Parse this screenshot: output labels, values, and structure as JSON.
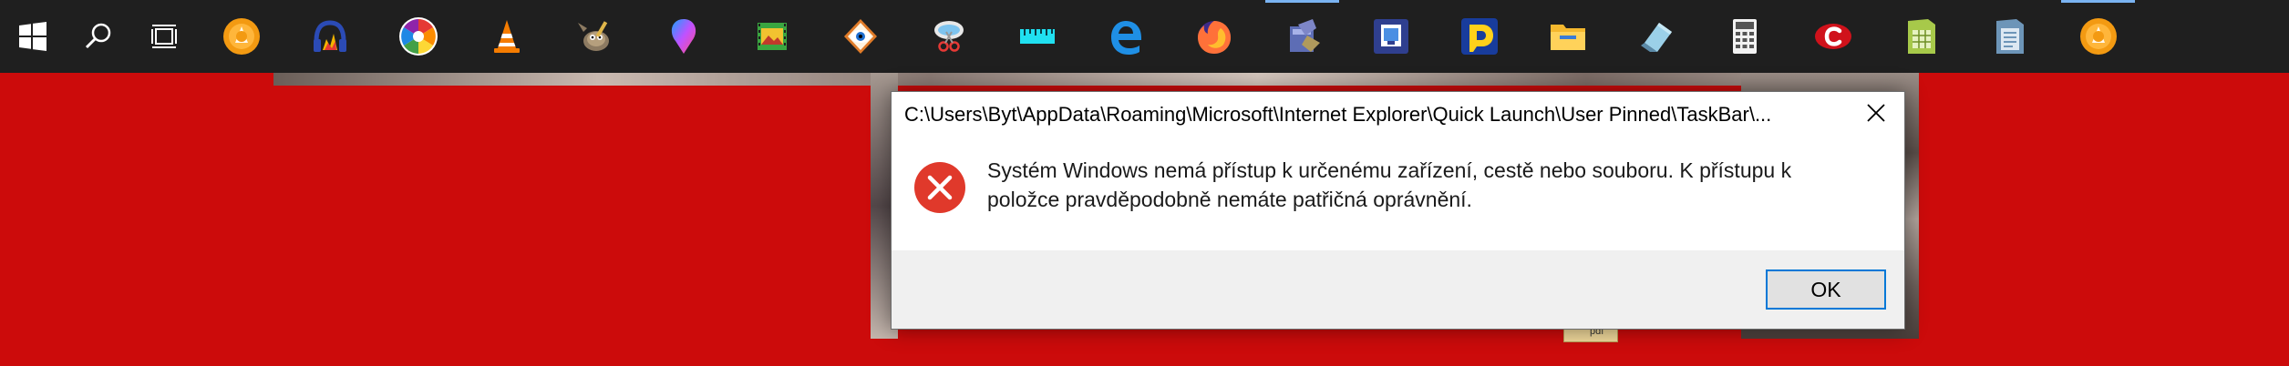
{
  "taskbar": {
    "pinned": [
      {
        "icon": "start-windows-icon"
      },
      {
        "icon": "search-icon"
      },
      {
        "icon": "task-view-icon"
      },
      {
        "icon": "orange-circle-app-icon"
      },
      {
        "icon": "audio-editor-icon"
      },
      {
        "icon": "aperture-icon"
      },
      {
        "icon": "vlc-cone-icon"
      },
      {
        "icon": "gimp-icon"
      },
      {
        "icon": "paint-balloon-icon"
      },
      {
        "icon": "film-strip-icon"
      },
      {
        "icon": "eye-viewer-icon"
      },
      {
        "icon": "scissors-tool-icon"
      },
      {
        "icon": "cyan-ruler-icon"
      },
      {
        "icon": "edge-browser-icon"
      },
      {
        "icon": "firefox-icon"
      },
      {
        "icon": "archive-tool-icon",
        "active": true
      },
      {
        "icon": "screen-capture-icon"
      },
      {
        "icon": "yellow-d-app-icon"
      },
      {
        "icon": "file-explorer-icon"
      },
      {
        "icon": "eraser-icon"
      },
      {
        "icon": "calculator-icon"
      },
      {
        "icon": "red-c-app-icon"
      },
      {
        "icon": "green-spreadsheet-icon"
      },
      {
        "icon": "document-viewer-icon"
      },
      {
        "icon": "orange-circle-app-icon-2",
        "active": true
      }
    ]
  },
  "desktop": {
    "icon_stub_label": "pdf"
  },
  "dialog": {
    "title": "C:\\Users\\Byt\\AppData\\Roaming\\Microsoft\\Internet Explorer\\Quick Launch\\User Pinned\\TaskBar\\...",
    "message": "Systém Windows nemá přístup k určenému zařízení, cestě nebo souboru. K přístupu k položce pravděpodobně nemáte patřičná oprávnění.",
    "ok_label": "OK",
    "close_icon": "close-icon",
    "status_icon": "error-icon",
    "colors": {
      "error_red": "#e0392b",
      "accent": "#0078d7",
      "footer": "#f0f0f0"
    }
  },
  "colors": {
    "desktop_background": "#cc0b0b",
    "taskbar": "#1f1f1f"
  }
}
